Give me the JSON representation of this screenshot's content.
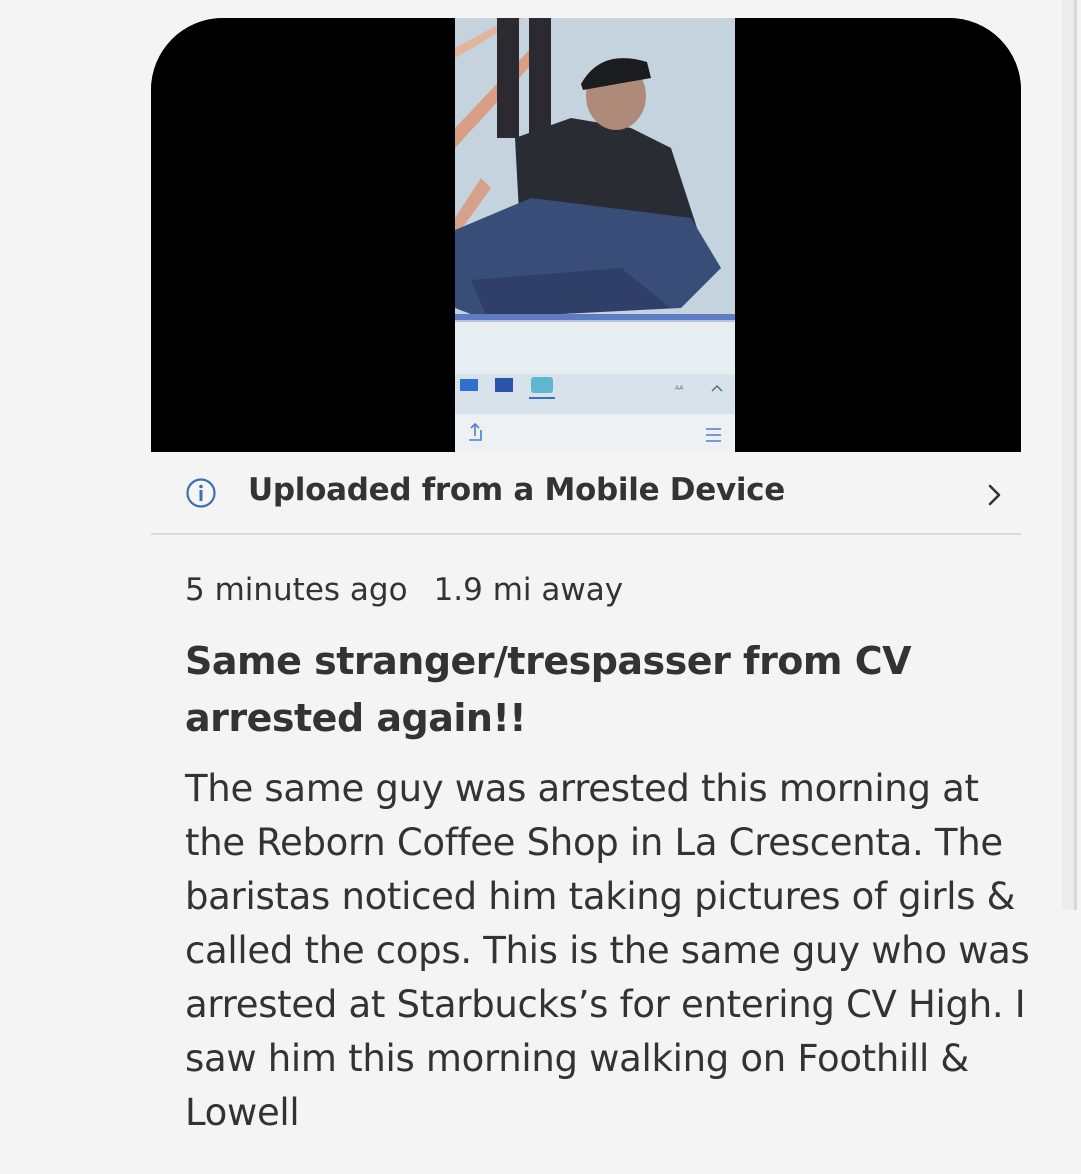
{
  "media": {
    "icon": "video-still",
    "colors": {
      "background": "#000000"
    }
  },
  "upload_info": {
    "label": "Uploaded from a Mobile Device",
    "icon": "info-icon",
    "chevron": "chevron-right-icon"
  },
  "post": {
    "time_ago": "5 minutes ago",
    "distance": "1.9 mi away",
    "title": "Same stranger/trespasser from CV arrested again!!",
    "body": "The same guy was arrested this morning at the Reborn Coffee Shop in La Crescenta. The baristas noticed him taking pictures of girls & called the cops. This is the same guy who was arrested at Starbucks’s for entering CV High. I saw him this morning walking on Foothill & Lowell"
  },
  "colors": {
    "text": "#333333",
    "page_background": "#f4f4f4",
    "accent": "#3b6fb6"
  }
}
